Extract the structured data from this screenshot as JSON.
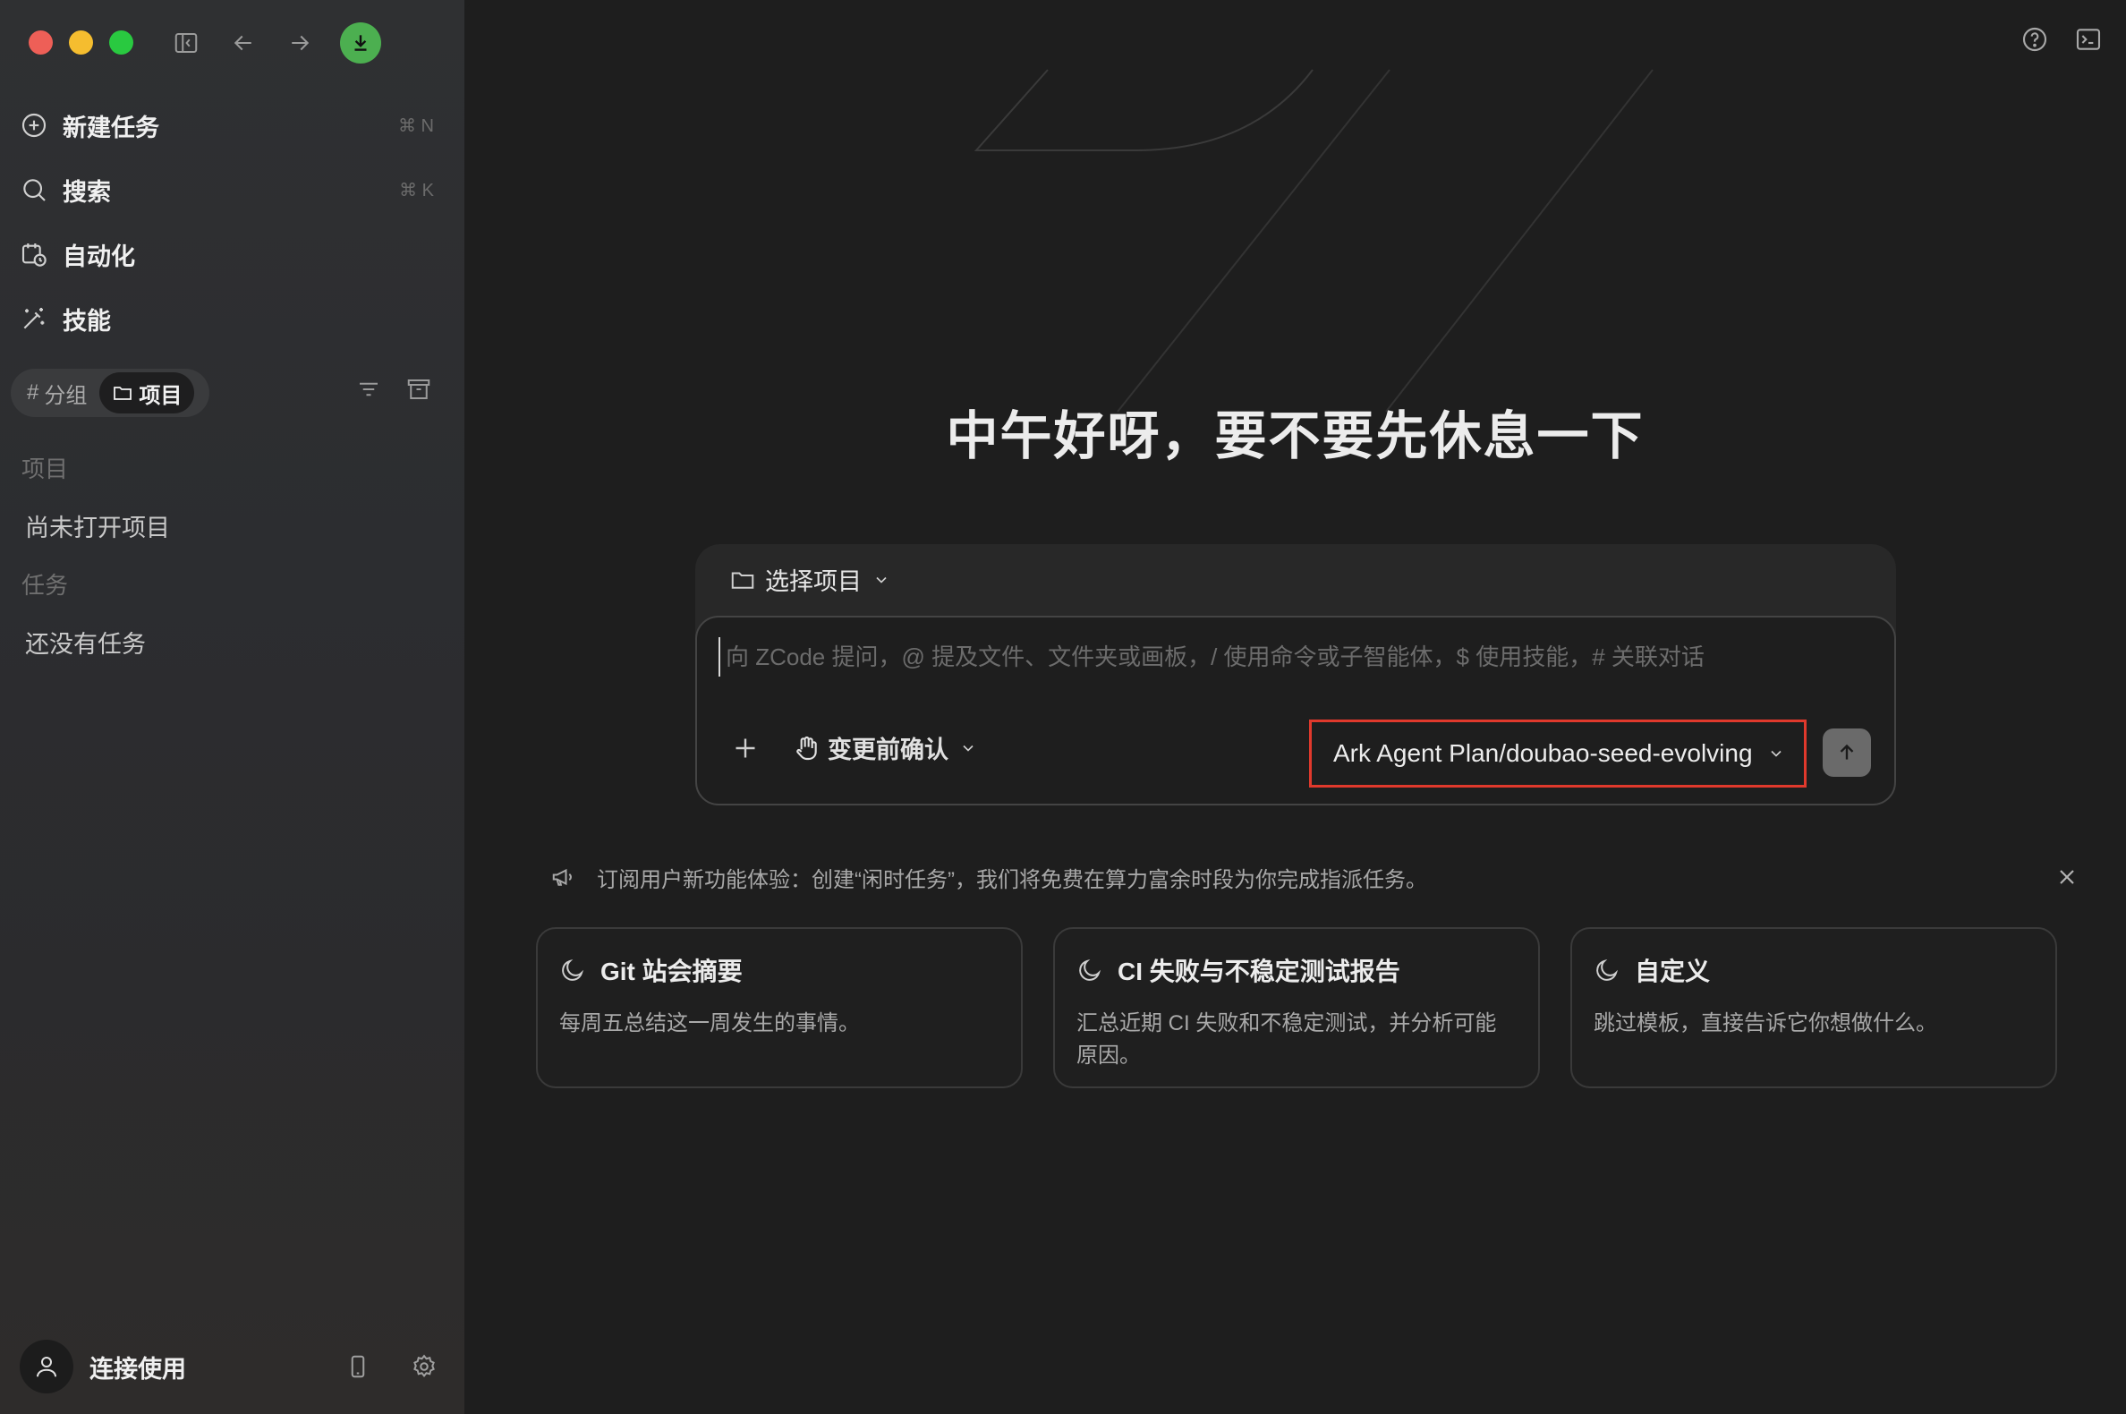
{
  "sidebar": {
    "nav": [
      {
        "label": "新建任务",
        "icon": "plus-circle-icon",
        "shortcut": "⌘ N"
      },
      {
        "label": "搜索",
        "icon": "search-icon",
        "shortcut": "⌘ K"
      },
      {
        "label": "自动化",
        "icon": "calendar-clock-icon",
        "shortcut": ""
      },
      {
        "label": "技能",
        "icon": "magic-wand-icon",
        "shortcut": ""
      }
    ],
    "segment": {
      "group_label": "分组",
      "project_label": "项目",
      "active": "project"
    },
    "projects_heading": "项目",
    "projects_empty": "尚未打开项目",
    "tasks_heading": "任务",
    "tasks_empty": "还没有任务",
    "user_label": "连接使用"
  },
  "main": {
    "greeting": "中午好呀，要不要先休息一下",
    "composer": {
      "project_select_label": "选择项目",
      "placeholder": "向 ZCode 提问，@ 提及文件、文件夹或画板，/ 使用命令或子智能体，$ 使用技能，# 关联对话",
      "confirm_label": "变更前确认",
      "model_label": "Ark Agent Plan/doubao-seed-evolving"
    },
    "notice": "订阅用户新功能体验：创建“闲时任务”，我们将免费在算力富余时段为你完成指派任务。",
    "cards": [
      {
        "title": "Git 站会摘要",
        "desc": "每周五总结这一周发生的事情。",
        "icon": "moon-icon"
      },
      {
        "title": "CI 失败与不稳定测试报告",
        "desc": "汇总近期 CI 失败和不稳定测试，并分析可能原因。",
        "icon": "moon-icon"
      },
      {
        "title": "自定义",
        "desc": "跳过模板，直接告诉它你想做什么。",
        "icon": "moon-icon"
      }
    ]
  },
  "colors": {
    "sidebar_bg": "#2e2f31",
    "main_bg": "#1e1e1e",
    "highlight_border": "#e0392c",
    "download_badge": "#4caf50"
  }
}
